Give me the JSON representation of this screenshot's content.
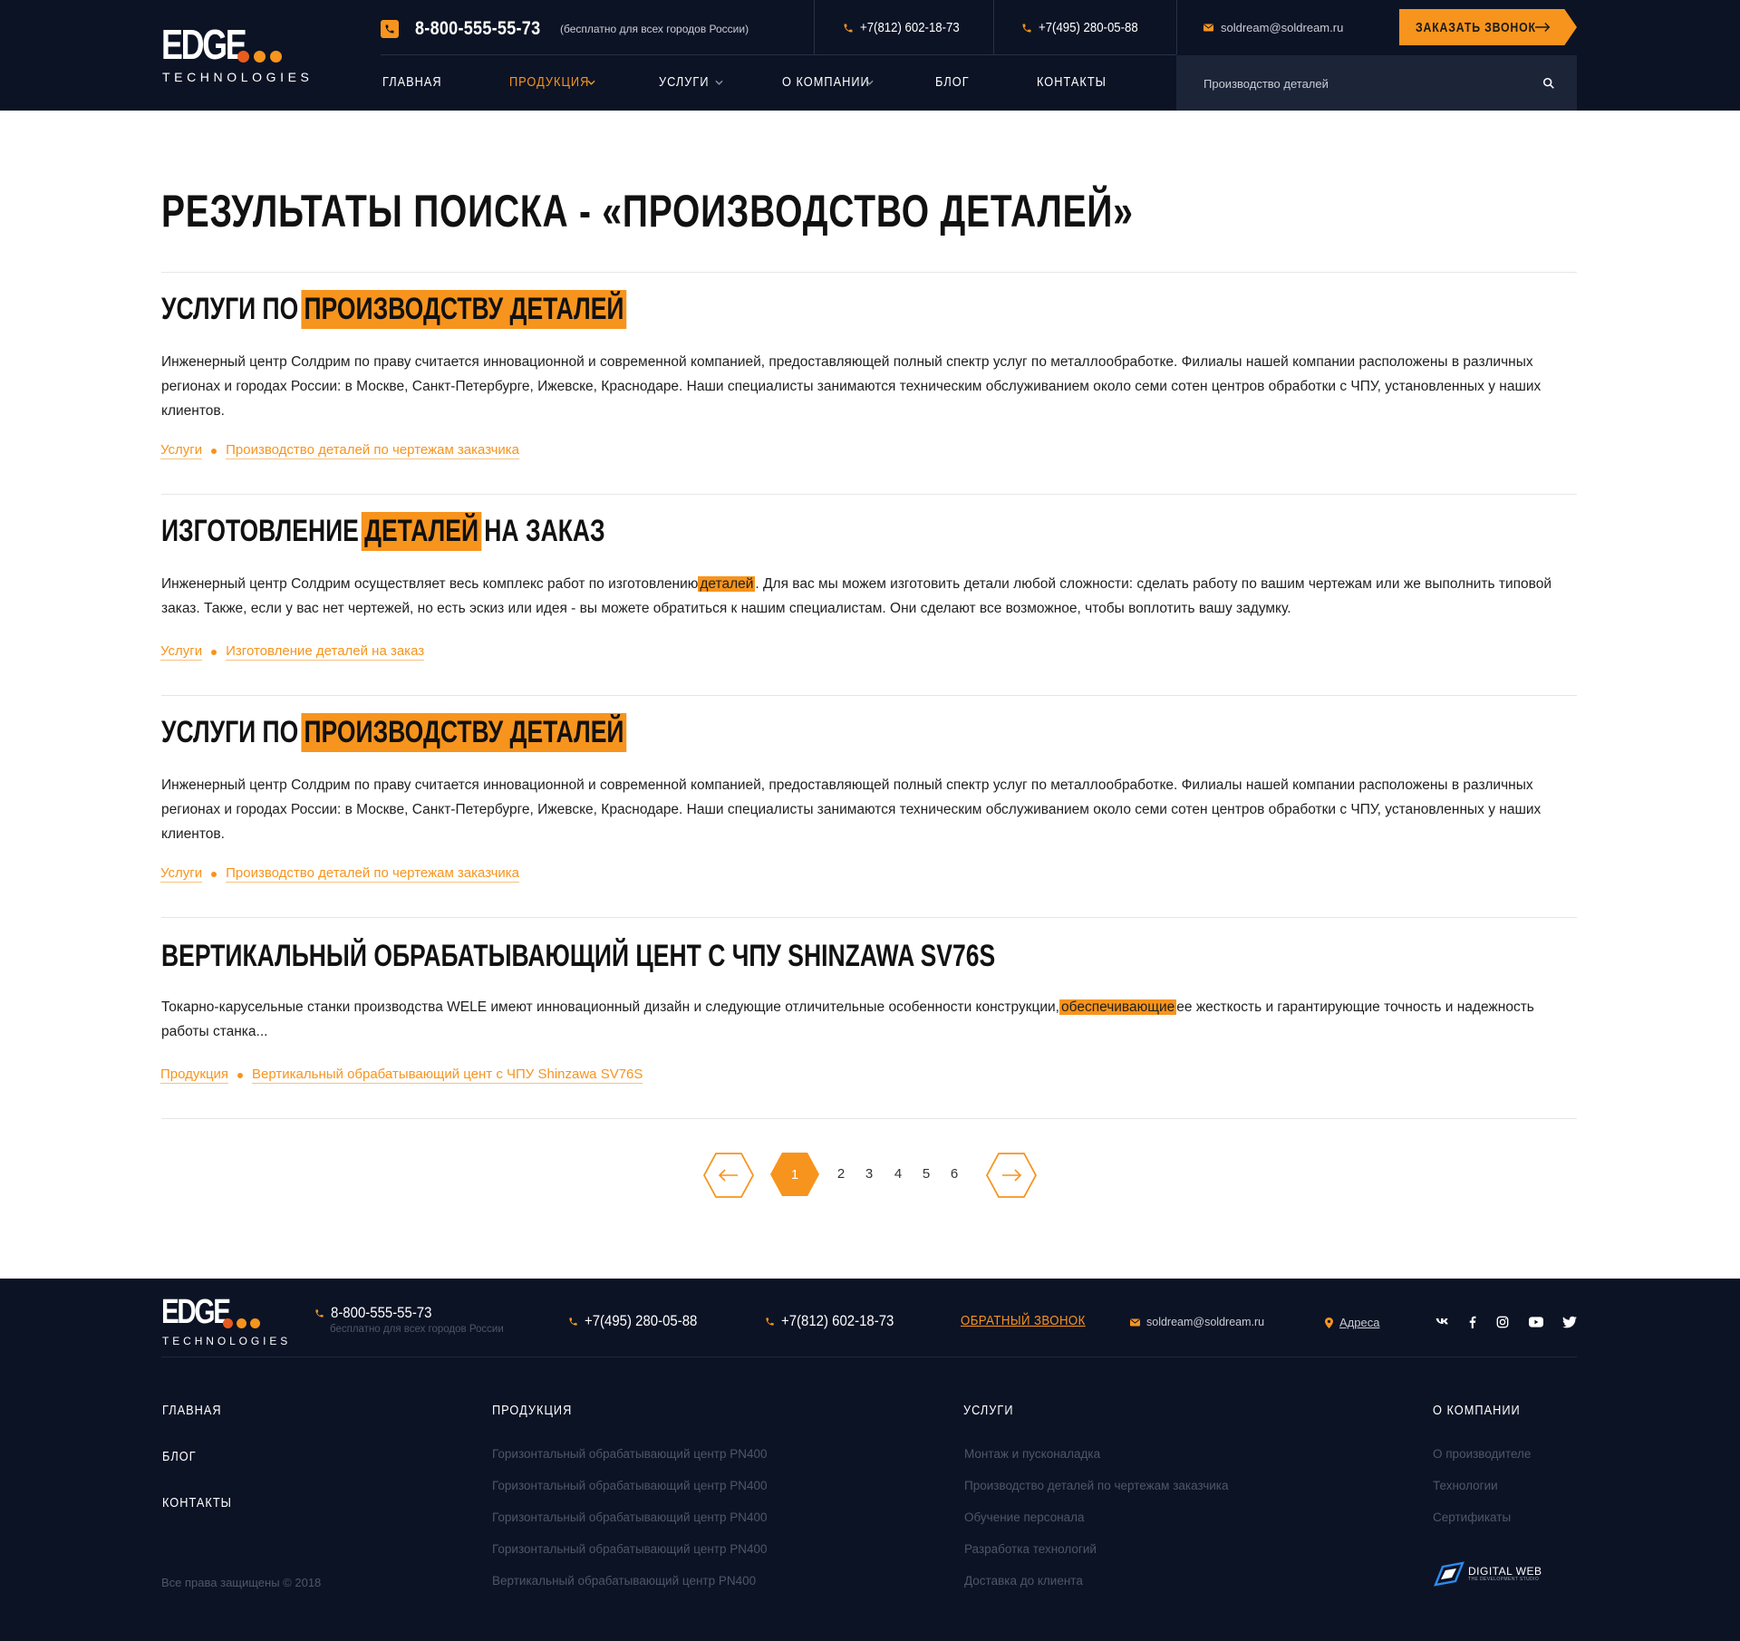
{
  "logo": {
    "word": "EDGE",
    "sub": "TECHNOLOGIES"
  },
  "header": {
    "main_phone": "8-800-555-55-73",
    "main_phone_note": "(бесплатно для всех городов России)",
    "phone_spb": "+7(812) 602-18-73",
    "phone_msk": "+7(495) 280-05-88",
    "email": "soldream@soldream.ru",
    "call_button": "ЗАКАЗАТЬ ЗВОНОК"
  },
  "nav": [
    {
      "label": "ГЛАВНАЯ"
    },
    {
      "label": "ПРОДУКЦИЯ"
    },
    {
      "label": "УСЛУГИ"
    },
    {
      "label": "О КОМПАНИИ"
    },
    {
      "label": "БЛОГ"
    },
    {
      "label": "КОНТАКТЫ"
    }
  ],
  "search": {
    "value": "Производство деталей"
  },
  "colors": {
    "accent": "#f7941d",
    "dark": "#0c1325",
    "search_bg": "#1c2438"
  },
  "page_title": "РЕЗУЛЬТАТЫ ПОИСКА - «ПРОИЗВОДСТВО ДЕТАЛЕЙ»",
  "results": [
    {
      "title_pre": "УСЛУГИ ПО",
      "title_hl": "ПРОИЗВОДСТВУ ДЕТАЛЕЙ",
      "title_post": "",
      "text_pre": "Инженерный центр Солдрим по праву считается инновационной и современной компанией, предоставляющей полный спектр услуг по металлообработке. Филиалы нашей компании расположены в различных регионах и городах России: в Москве, Санкт-Петербурге, Ижевске, Краснодаре. Наши специалисты занимаются техническим обслуживанием около семи сотен центров обработки с ЧПУ, установленных у наших клиентов.",
      "text_hl": "",
      "text_post": "",
      "crumb_1": "Услуги",
      "crumb_2": "Производство деталей по чертежам заказчика"
    },
    {
      "title_pre": "ИЗГОТОВЛЕНИЕ",
      "title_hl": "ДЕТАЛЕЙ",
      "title_post": "НА ЗАКАЗ",
      "text_pre": "Инженерный центр Солдрим осуществляет весь комплекс работ по изготовлению",
      "text_hl": "деталей",
      "text_post": ". Для вас мы можем изготовить детали любой сложности: сделать работу по вашим чертежам или же выполнить типовой заказ. Также, если у вас нет чертежей, но есть эскиз или идея - вы можете обратиться к нашим специалистам. Они сделают все возможное, чтобы воплотить вашу задумку.",
      "crumb_1": "Услуги",
      "crumb_2": "Изготовление деталей на заказ"
    },
    {
      "title_pre": "УСЛУГИ ПО",
      "title_hl": "ПРОИЗВОДСТВУ ДЕТАЛЕЙ",
      "title_post": "",
      "text_pre": "Инженерный центр Солдрим по праву считается инновационной и современной компанией, предоставляющей полный спектр услуг по металлообработке. Филиалы нашей компании расположены в различных регионах и городах России: в Москве, Санкт-Петербурге, Ижевске, Краснодаре. Наши специалисты занимаются техническим обслуживанием около семи сотен центров обработки с ЧПУ, установленных у наших клиентов.",
      "text_hl": "",
      "text_post": "",
      "crumb_1": "Услуги",
      "crumb_2": "Производство деталей по чертежам заказчика"
    },
    {
      "title_pre": "ВЕРТИКАЛЬНЫЙ ОБРАБАТЫВАЮЩИЙ ЦЕНТ С ЧПУ SHINZAWA SV76S",
      "title_hl": "",
      "title_post": "",
      "text_pre": "Токарно-карусельные станки производства WELE имеют инновационный дизайн и следующие отличительные особенности конструкции,",
      "text_hl": "обеспечивающие",
      "text_post": "ее жесткость и гарантирующие точность и надежность работы станка...",
      "crumb_1": "Продукция",
      "crumb_2": "Вертикальный обрабатывающий цент с ЧПУ Shinzawa SV76S"
    }
  ],
  "pagination": {
    "current": "1",
    "pages": [
      "2",
      "3",
      "4",
      "5",
      "6"
    ]
  },
  "footer": {
    "phone_main": "8-800-555-55-73",
    "phone_note": "бесплатно для всех городов России",
    "phone_msk": "+7(495) 280-05-88",
    "phone_spb": "+7(812) 602-18-73",
    "callback": "ОБРАТНЫЙ ЗВОНОК",
    "email": "soldream@soldream.ru",
    "address": "Адреса",
    "social_icons": [
      "vk-icon",
      "facebook-icon",
      "instagram-icon",
      "youtube-icon",
      "twitter-icon"
    ],
    "col_main": [
      "ГЛАВНАЯ",
      "БЛОГ",
      "КОНТАКТЫ"
    ],
    "col_products_head": "ПРОДУКЦИЯ",
    "col_products": [
      "Горизонтальный обрабатывающий центр PN400",
      "Горизонтальный обрабатывающий центр PN400",
      "Горизонтальный обрабатывающий центр PN400",
      "Горизонтальный обрабатывающий центр PN400",
      "Вертикальный обрабатывающий центр PN400"
    ],
    "col_services_head": "УСЛУГИ",
    "col_services": [
      "Монтаж и пусконаладка",
      "Производство деталей по чертежам заказчика",
      "Обучение персонала",
      "Разработка технологий",
      "Доставка до клиента"
    ],
    "col_about_head": "О КОМПАНИИ",
    "col_about": [
      "О производителе",
      "Технологии",
      "Сертификаты"
    ],
    "copyright": "Все права защищены © 2018",
    "dev_name": "DIGITAL WEB",
    "dev_sub": "THE DEVELOPMENT STUDIO"
  }
}
